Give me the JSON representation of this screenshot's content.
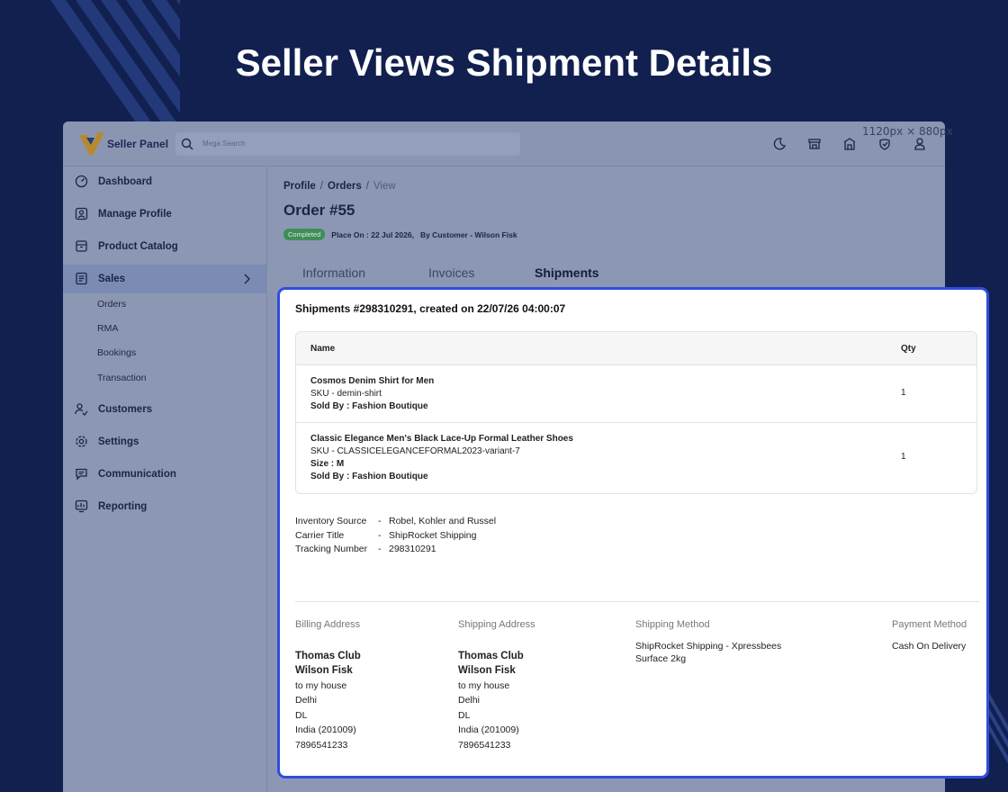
{
  "page_title": "Seller Views Shipment Details",
  "dimension_label": "1120px × 880px",
  "colors": {
    "background": "#11204f",
    "highlight_border": "#2f4ede",
    "status_green": "#3f8e59"
  },
  "header": {
    "brand": "Seller Panel",
    "search_placeholder": "Mega Search",
    "icons": [
      "moon-icon",
      "store-icon",
      "building-icon",
      "shield-icon",
      "user-icon"
    ]
  },
  "sidebar": {
    "items": [
      {
        "label": "Dashboard",
        "icon": "gauge-icon"
      },
      {
        "label": "Manage Profile",
        "icon": "profile-icon"
      },
      {
        "label": "Product Catalog",
        "icon": "box-icon"
      },
      {
        "label": "Sales",
        "icon": "receipt-icon"
      },
      {
        "label": "Customers",
        "icon": "customers-icon"
      },
      {
        "label": "Settings",
        "icon": "gear-icon"
      },
      {
        "label": "Communication",
        "icon": "chat-icon"
      },
      {
        "label": "Reporting",
        "icon": "report-icon"
      }
    ],
    "sales_subitems": [
      "Orders",
      "RMA",
      "Bookings",
      "Transaction"
    ]
  },
  "breadcrumb": {
    "items": [
      "Profile",
      "Orders",
      "View"
    ]
  },
  "order": {
    "title": "Order #55",
    "status": "Completed",
    "placed_on": "Place On : 22 Jul 2026,",
    "by_customer": "By Customer - Wilson Fisk"
  },
  "tabs": [
    "Information",
    "Invoices",
    "Shipments"
  ],
  "shipment": {
    "heading": "Shipments #298310291, created on 22/07/26 04:00:07",
    "columns": {
      "name": "Name",
      "qty": "Qty"
    },
    "items": [
      {
        "name": "Cosmos Denim Shirt for Men",
        "sku": "SKU - demin-shirt",
        "size": "",
        "sold_by": "Sold By : Fashion Boutique",
        "qty": "1"
      },
      {
        "name": "Classic Elegance Men's Black Lace-Up Formal Leather Shoes",
        "sku": "SKU - CLASSICELEGANCEFORMAL2023-variant-7",
        "size": "Size : M",
        "sold_by": "Sold By : Fashion Boutique",
        "qty": "1"
      }
    ],
    "info": [
      {
        "label": "Inventory Source",
        "value": "Robel, Kohler and Russel"
      },
      {
        "label": "Carrier Title",
        "value": "ShipRocket Shipping"
      },
      {
        "label": "Tracking Number",
        "value": "298310291"
      }
    ],
    "billing": {
      "heading": "Billing Address",
      "company": "Thomas Club",
      "name": "Wilson Fisk",
      "lines": [
        "to my house",
        "Delhi",
        "DL",
        "India (201009)",
        "7896541233"
      ]
    },
    "shipping": {
      "heading": "Shipping Address",
      "company": "Thomas Club",
      "name": "Wilson Fisk",
      "lines": [
        "to my house",
        "Delhi",
        "DL",
        "India (201009)",
        "7896541233"
      ]
    },
    "shipping_method": {
      "heading": "Shipping Method",
      "line1": "ShipRocket Shipping - Xpressbees",
      "line2": "Surface 2kg"
    },
    "payment_method": {
      "heading": "Payment Method",
      "value": "Cash On Delivery"
    }
  }
}
